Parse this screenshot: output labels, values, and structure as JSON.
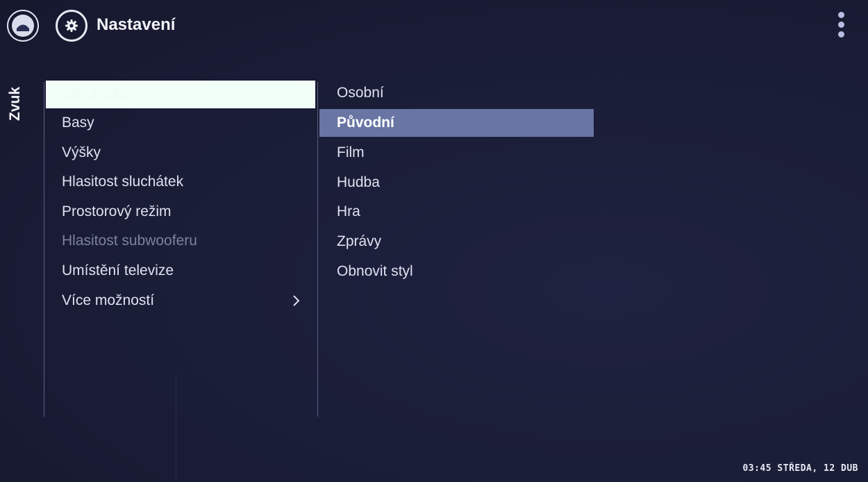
{
  "header": {
    "title": "Nastavení",
    "home_icon": "home-icon",
    "settings_icon": "gear-icon",
    "more_icon": "more-vertical-icon"
  },
  "section": {
    "label": "Zvuk"
  },
  "menu": {
    "items": [
      {
        "label": "Styl zvuku",
        "state": "selected"
      },
      {
        "label": "Basy",
        "state": "normal"
      },
      {
        "label": "Výšky",
        "state": "normal"
      },
      {
        "label": "Hlasitost sluchátek",
        "state": "normal"
      },
      {
        "label": "Prostorový režim",
        "state": "normal"
      },
      {
        "label": "Hlasitost subwooferu",
        "state": "disabled"
      },
      {
        "label": "Umístění televize",
        "state": "normal"
      },
      {
        "label": "Více možností",
        "state": "normal",
        "has_submenu": true
      }
    ]
  },
  "submenu": {
    "items": [
      {
        "label": "Osobní"
      },
      {
        "label": "Původní",
        "active": true
      },
      {
        "label": "Film"
      },
      {
        "label": "Hudba"
      },
      {
        "label": "Hra"
      },
      {
        "label": "Zprávy"
      },
      {
        "label": "Obnovit styl"
      }
    ]
  },
  "status": {
    "clock": "03:45 STŘEDA, 12 DUB"
  },
  "colors": {
    "background": "#1b1e38",
    "selected_item": "#f2fff9",
    "active_option": "#6976a4",
    "disabled_text": "#7c82a0"
  }
}
